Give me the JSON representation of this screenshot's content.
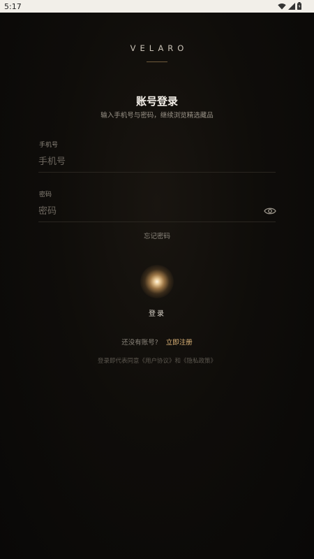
{
  "status_bar": {
    "time": "5:17"
  },
  "brand": {
    "name": "VELARO"
  },
  "header": {
    "title": "账号登录",
    "subtitle": "输入手机号与密码，继续浏览精选藏品"
  },
  "form": {
    "phone": {
      "label": "手机号",
      "placeholder": "手机号",
      "value": ""
    },
    "password": {
      "label": "密码",
      "placeholder": "密码",
      "value": ""
    },
    "forgot_label": "忘记密码",
    "login_label": "登录"
  },
  "register": {
    "prompt": "还没有账号?",
    "link": "立即注册"
  },
  "agreement": "登录即代表同意《用户协议》和《隐私政策》",
  "colors": {
    "accent": "#e0b77a",
    "background": "#0b0a08",
    "status_bar": "#f2efe9"
  }
}
